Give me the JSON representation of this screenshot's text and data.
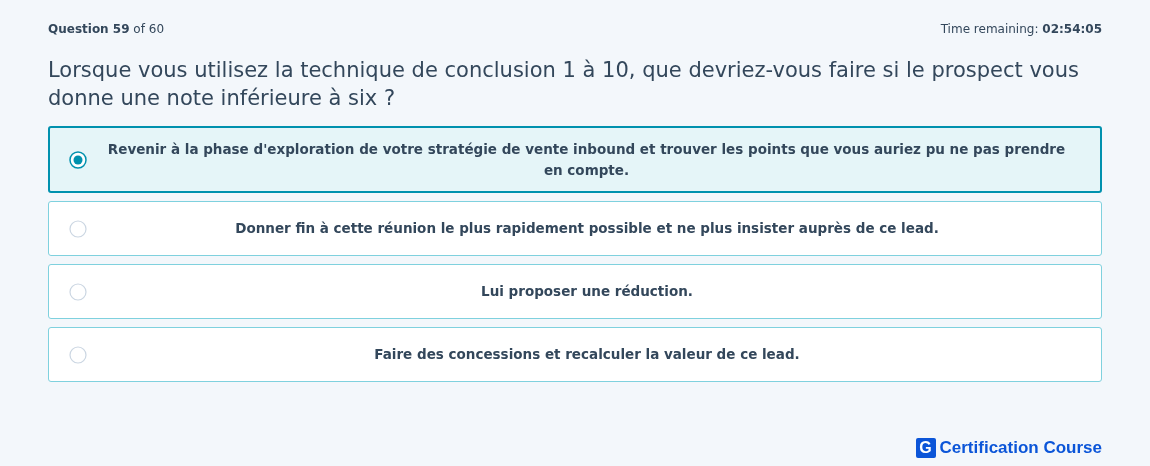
{
  "progress": "**Question 59** of 60",
  "timer": "Time remaining: **02:54:05**",
  "question": "Lorsque vous utilisez la technique de conclusion 1 à 10, que devriez-vous faire si le prospect vous donne une note inférieure à six ?",
  "options": [
    {
      "label": "Revenir à la phase d'exploration de votre stratégie de vente inbound et trouver les points que vous auriez pu ne pas prendre en compte.",
      "selected": true
    },
    {
      "label": "Donner fin à cette réunion le plus rapidement possible et ne plus insister auprès de ce lead.",
      "selected": false
    },
    {
      "label": "Lui proposer une réduction.",
      "selected": false
    },
    {
      "label": "Faire des concessions et recalculer la valeur de ce lead.",
      "selected": false
    }
  ],
  "brand": {
    "mark": "G",
    "name": "Certification Course"
  }
}
